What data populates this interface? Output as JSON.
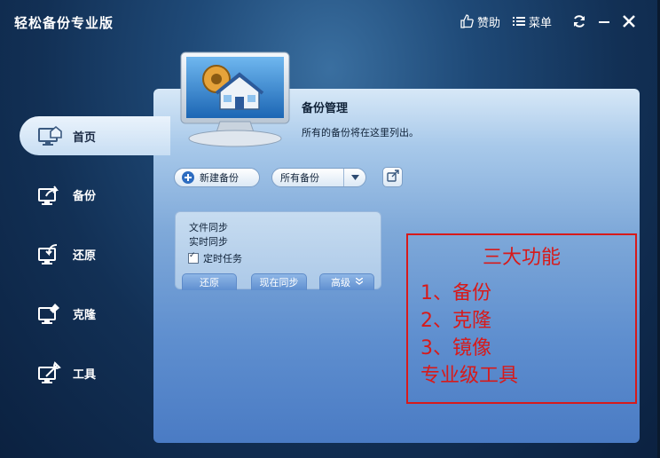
{
  "app": {
    "title": "轻松备份专业版"
  },
  "titlebar": {
    "like_label": "赞助",
    "menu_label": "菜单"
  },
  "sidebar": {
    "items": [
      {
        "label": "首页",
        "active": true
      },
      {
        "label": "备份"
      },
      {
        "label": "还原"
      },
      {
        "label": "克隆"
      },
      {
        "label": "工具"
      }
    ]
  },
  "main": {
    "title": "备份管理",
    "subtitle": "所有的备份将在这里列出。",
    "new_backup_label": "新建备份",
    "filter_value": "所有备份"
  },
  "task_card": {
    "line1": "文件同步",
    "line2": "实时同步",
    "checkbox_label": "定时任务",
    "checkbox_checked": true,
    "restore_label": "还原",
    "sync_now_label": "现在同步",
    "advanced_label": "高级"
  },
  "annotation": {
    "title": "三大功能",
    "items": [
      "1、备份",
      "2、克隆",
      "3、镜像",
      "专业级工具"
    ]
  },
  "colors": {
    "annotation_red": "#d71a1a",
    "accent_blue": "#4a7bc4"
  }
}
